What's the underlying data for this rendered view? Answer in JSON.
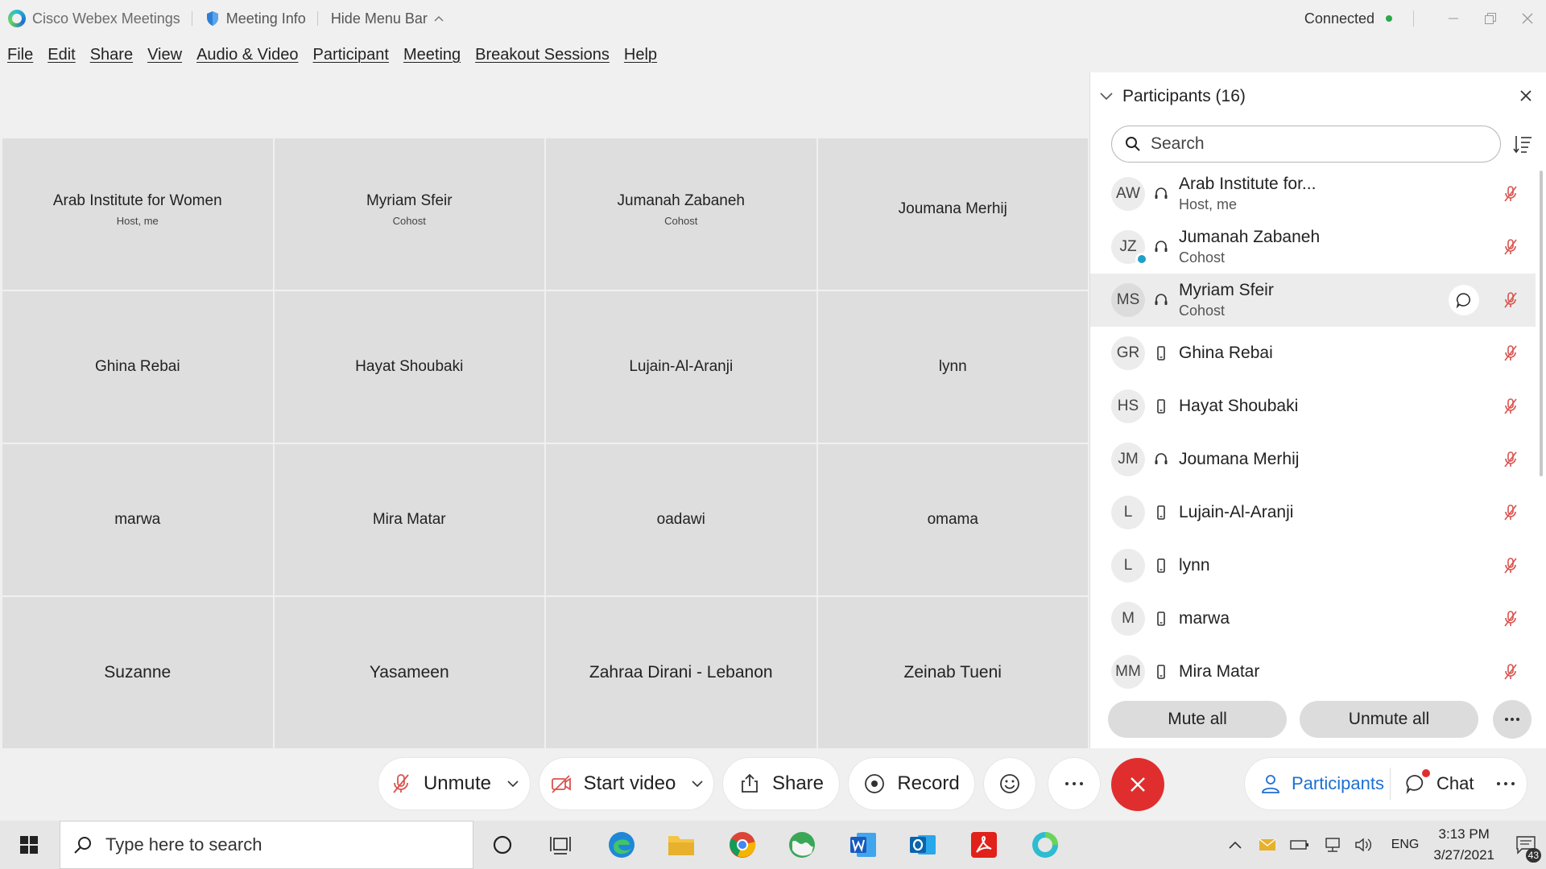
{
  "titlebar": {
    "app_name": "Cisco Webex Meetings",
    "meeting_info": "Meeting Info",
    "hide_menu": "Hide Menu Bar",
    "status": "Connected",
    "status_color": "#2aa84a"
  },
  "menu": [
    "File",
    "Edit",
    "Share",
    "View",
    "Audio & Video",
    "Participant",
    "Meeting",
    "Breakout Sessions",
    "Help"
  ],
  "grid": [
    {
      "name": "Arab Institute for Women",
      "role": "Host, me"
    },
    {
      "name": "Myriam Sfeir",
      "role": "Cohost"
    },
    {
      "name": "Jumanah Zabaneh",
      "role": "Cohost"
    },
    {
      "name": "Joumana Merhij",
      "role": ""
    },
    {
      "name": "Ghina Rebai",
      "role": ""
    },
    {
      "name": "Hayat Shoubaki",
      "role": ""
    },
    {
      "name": "Lujain-Al-Aranji",
      "role": ""
    },
    {
      "name": "lynn",
      "role": ""
    },
    {
      "name": "marwa",
      "role": ""
    },
    {
      "name": "Mira Matar",
      "role": ""
    },
    {
      "name": "oadawi",
      "role": ""
    },
    {
      "name": "omama",
      "role": ""
    },
    {
      "name": "Suzanne",
      "role": ""
    },
    {
      "name": "Yasameen",
      "role": ""
    },
    {
      "name": "Zahraa Dirani - Lebanon",
      "role": ""
    },
    {
      "name": "Zeinab Tueni",
      "role": ""
    }
  ],
  "panel": {
    "title": "Participants (16)",
    "search_placeholder": "Search",
    "participants": [
      {
        "initials": "AW",
        "name": "Arab Institute for...",
        "role": "Host, me",
        "device": "headset-icon"
      },
      {
        "initials": "JZ",
        "name": "Jumanah Zabaneh",
        "role": "Cohost",
        "device": "headset-icon"
      },
      {
        "initials": "MS",
        "name": "Myriam Sfeir",
        "role": "Cohost",
        "device": "headset-icon"
      },
      {
        "initials": "GR",
        "name": "Ghina Rebai",
        "role": "",
        "device": "phone-icon"
      },
      {
        "initials": "HS",
        "name": "Hayat Shoubaki",
        "role": "",
        "device": "phone-icon"
      },
      {
        "initials": "JM",
        "name": "Joumana Merhij",
        "role": "",
        "device": "headset-icon"
      },
      {
        "initials": "L",
        "name": "Lujain-Al-Aranji",
        "role": "",
        "device": "phone-icon"
      },
      {
        "initials": "L",
        "name": "lynn",
        "role": "",
        "device": "phone-icon"
      },
      {
        "initials": "M",
        "name": "marwa",
        "role": "",
        "device": "phone-icon"
      },
      {
        "initials": "MM",
        "name": "Mira Matar",
        "role": "",
        "device": "phone-icon"
      }
    ],
    "mute_all": "Mute all",
    "unmute_all": "Unmute all",
    "muted_color": "#d9534f"
  },
  "controls": {
    "unmute": "Unmute",
    "start_video": "Start video",
    "share": "Share",
    "record": "Record",
    "participants": "Participants",
    "chat": "Chat",
    "end_color": "#e02e2e",
    "accent": "#1d6fd1"
  },
  "taskbar": {
    "search_placeholder": "Type here to search",
    "lang": "ENG",
    "time": "3:13 PM",
    "date": "3/27/2021",
    "notifications": "43"
  }
}
